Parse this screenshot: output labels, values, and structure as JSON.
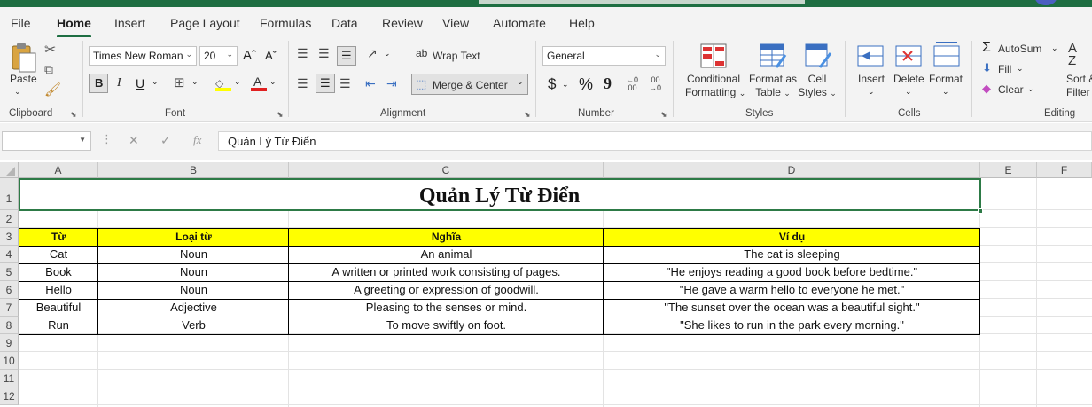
{
  "ribbon_tabs": [
    "File",
    "Home",
    "Insert",
    "Page Layout",
    "Formulas",
    "Data",
    "Review",
    "View",
    "Automate",
    "Help"
  ],
  "active_tab": "Home",
  "clipboard": {
    "paste": "Paste",
    "group": "Clipboard"
  },
  "font": {
    "name": "Times New Roman",
    "size": "20",
    "bold": "B",
    "italic": "I",
    "underline": "U",
    "group": "Font",
    "highlight_color": "#ffff00",
    "font_color": "#e02020"
  },
  "alignment": {
    "wrap_text": "Wrap Text",
    "merge_center": "Merge & Center",
    "group": "Alignment"
  },
  "number": {
    "format": "General",
    "currency": "$",
    "percent": "%",
    "comma": "9",
    "group": "Number"
  },
  "styles": {
    "conditional": [
      "Conditional",
      "Formatting"
    ],
    "format_table": [
      "Format as",
      "Table"
    ],
    "cell_styles": [
      "Cell",
      "Styles"
    ],
    "group": "Styles"
  },
  "cells": {
    "insert": "Insert",
    "delete": "Delete",
    "format": "Format",
    "group": "Cells"
  },
  "editing": {
    "autosum": "AutoSum",
    "fill": "Fill",
    "clear": "Clear",
    "sort": [
      "Sort &",
      "Filter"
    ],
    "group": "Editing"
  },
  "formula_bar": {
    "name_box": "",
    "formula": "Quản Lý Từ Điển"
  },
  "columns": [
    "A",
    "B",
    "C",
    "D",
    "E",
    "F"
  ],
  "rows": [
    "1",
    "2",
    "3",
    "4",
    "5",
    "6",
    "7",
    "8",
    "9",
    "10",
    "11",
    "12"
  ],
  "sheet": {
    "title": "Quản Lý Từ Điển",
    "headers": [
      "Từ",
      "Loại từ",
      "Nghĩa",
      "Ví dụ"
    ],
    "data": [
      [
        "Cat",
        "Noun",
        "An animal",
        "The cat is sleeping"
      ],
      [
        "Book",
        "Noun",
        "A written or printed work consisting of pages.",
        "\"He enjoys reading a good book before bedtime.\""
      ],
      [
        "Hello",
        "Noun",
        "A greeting or expression of goodwill.",
        "\"He gave a warm hello to everyone he met.\""
      ],
      [
        "Beautiful",
        "Adjective",
        "Pleasing to the senses or mind.",
        "\"The sunset over the ocean was a beautiful sight.\""
      ],
      [
        "Run",
        "Verb",
        "To move swiftly on foot.",
        "\"She likes to run in the park every morning.\""
      ]
    ]
  },
  "colors": {
    "accent": "#1e6e42",
    "header_fill": "#ffff00"
  }
}
